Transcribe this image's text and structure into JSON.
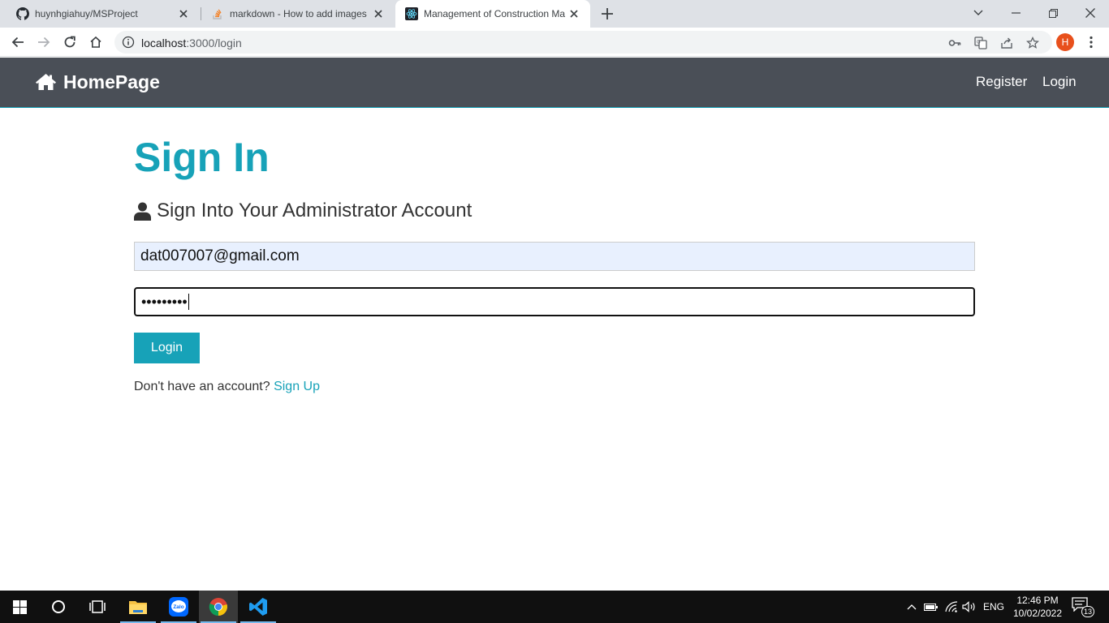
{
  "browser": {
    "tabs": [
      {
        "title": "huynhgiahuy/MSProject",
        "icon": "github-icon"
      },
      {
        "title": "markdown - How to add images",
        "icon": "stackoverflow-icon"
      },
      {
        "title": "Management of Construction Ma",
        "icon": "react-icon",
        "active": true
      }
    ],
    "url": {
      "host": "localhost",
      "path": ":3000/login"
    },
    "profile_initial": "H"
  },
  "navbar": {
    "brand": "HomePage",
    "links": [
      "Register",
      "Login"
    ]
  },
  "page": {
    "title": "Sign In",
    "lead": "Sign Into Your Administrator Account",
    "email_value": "dat007007@gmail.com",
    "password_masked": "•••••••••",
    "login_button": "Login",
    "signup_prompt": "Don't have an account?",
    "signup_link": "Sign Up"
  },
  "taskbar": {
    "apps": [
      "start-button",
      "cortana-search",
      "task-view",
      "file-explorer",
      "zalo",
      "chrome",
      "vscode"
    ],
    "language": "ENG",
    "time": "12:46 PM",
    "date": "10/02/2022",
    "notification_count": "13"
  },
  "colors": {
    "accent": "#17a2b8",
    "navbar": "#4a4f57",
    "tabstrip": "#dee1e6",
    "taskbar": "#101010"
  }
}
